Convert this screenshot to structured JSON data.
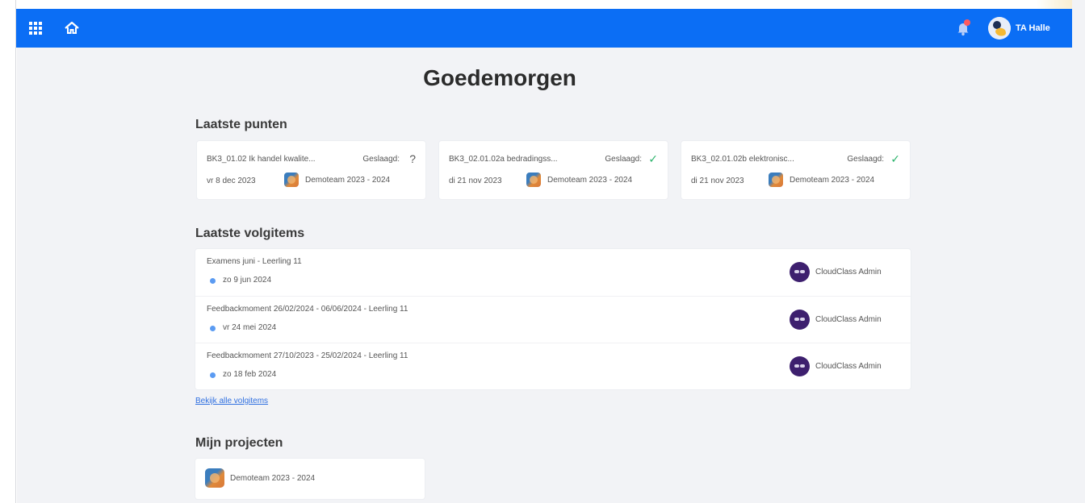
{
  "colors": {
    "topbar": "#0b6ef5",
    "background": "#f2f3f6",
    "success": "#2bb36b",
    "link": "#2f6fe0",
    "dot": "#5b9bf2",
    "badge": "#ff5a5f"
  },
  "header": {
    "apps_icon": "grid-icon",
    "home_icon": "home-icon",
    "notifications_icon": "bell-icon",
    "user_name": "TA Halle"
  },
  "greeting": "Goedemorgen",
  "latest_points": {
    "title": "Laatste punten",
    "items": [
      {
        "name": "BK3_01.02 Ik handel kwalite...",
        "status": "Geslaagd:",
        "mark": "?",
        "date": "vr 8 dec 2023",
        "team": "Demoteam 2023 - 2024"
      },
      {
        "name": "BK3_02.01.02a bedradingss...",
        "status": "Geslaagd:",
        "mark": "✓",
        "date": "di 21 nov 2023",
        "team": "Demoteam 2023 - 2024"
      },
      {
        "name": "BK3_02.01.02b elektronisc...",
        "status": "Geslaagd:",
        "mark": "✓",
        "date": "di 21 nov 2023",
        "team": "Demoteam 2023 - 2024"
      }
    ]
  },
  "follow_items": {
    "title": "Laatste volgitems",
    "items": [
      {
        "title": "Examens juni - Leerling 11",
        "date": "zo 9 jun 2024",
        "user": "CloudClass Admin"
      },
      {
        "title": "Feedbackmoment 26/02/2024 - 06/06/2024 - Leerling 11",
        "date": "vr 24 mei 2024",
        "user": "CloudClass Admin"
      },
      {
        "title": "Feedbackmoment 27/10/2023 - 25/02/2024 - Leerling 11",
        "date": "zo 18 feb 2024",
        "user": "CloudClass Admin"
      }
    ],
    "view_all": "Bekijk alle volgitems"
  },
  "projects": {
    "title": "Mijn projecten",
    "items": [
      {
        "name": "Demoteam 2023 - 2024"
      }
    ]
  }
}
